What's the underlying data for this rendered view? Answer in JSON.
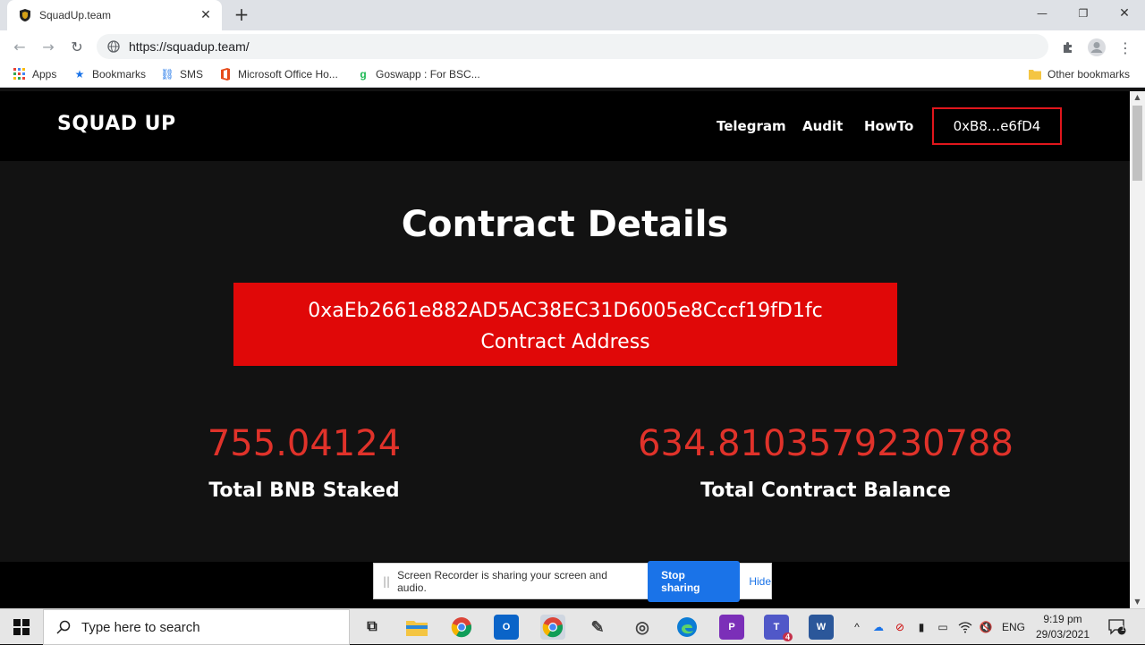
{
  "browser": {
    "tab_title": "SquadUp.team",
    "url": "https://squadup.team/",
    "bookmarks": [
      {
        "label": "Apps"
      },
      {
        "label": "Bookmarks"
      },
      {
        "label": "SMS"
      },
      {
        "label": "Microsoft Office Ho..."
      },
      {
        "label": "Goswapp : For BSC..."
      }
    ],
    "other_bookmarks": "Other bookmarks"
  },
  "site": {
    "logo": "SQUAD UP",
    "nav": [
      "Telegram",
      "Audit",
      "HowTo"
    ],
    "wallet": "0xB8...e6fD4",
    "heading": "Contract Details",
    "contract_address": "0xaEb2661e882AD5AC38EC31D6005e8Cccf19fD1fc",
    "contract_address_label": "Contract Address",
    "stats": [
      {
        "value": "755.04124",
        "label": "Total BNB Staked"
      },
      {
        "value": "634.8103579230788",
        "label": "Total Contract Balance"
      }
    ]
  },
  "recorder": {
    "message": "Screen Recorder is sharing your screen and audio.",
    "stop_label": "Stop sharing",
    "hide_label": "Hide"
  },
  "taskbar": {
    "search_placeholder": "Type here to search",
    "language": "ENG",
    "time": "9:19 pm",
    "date": "29/03/2021",
    "notification_count": "1",
    "teams_badge": "4"
  },
  "colors": {
    "accent_red": "#e00808",
    "value_red": "#e0322a",
    "page_bg": "#121212",
    "nav_bg": "#000000"
  }
}
